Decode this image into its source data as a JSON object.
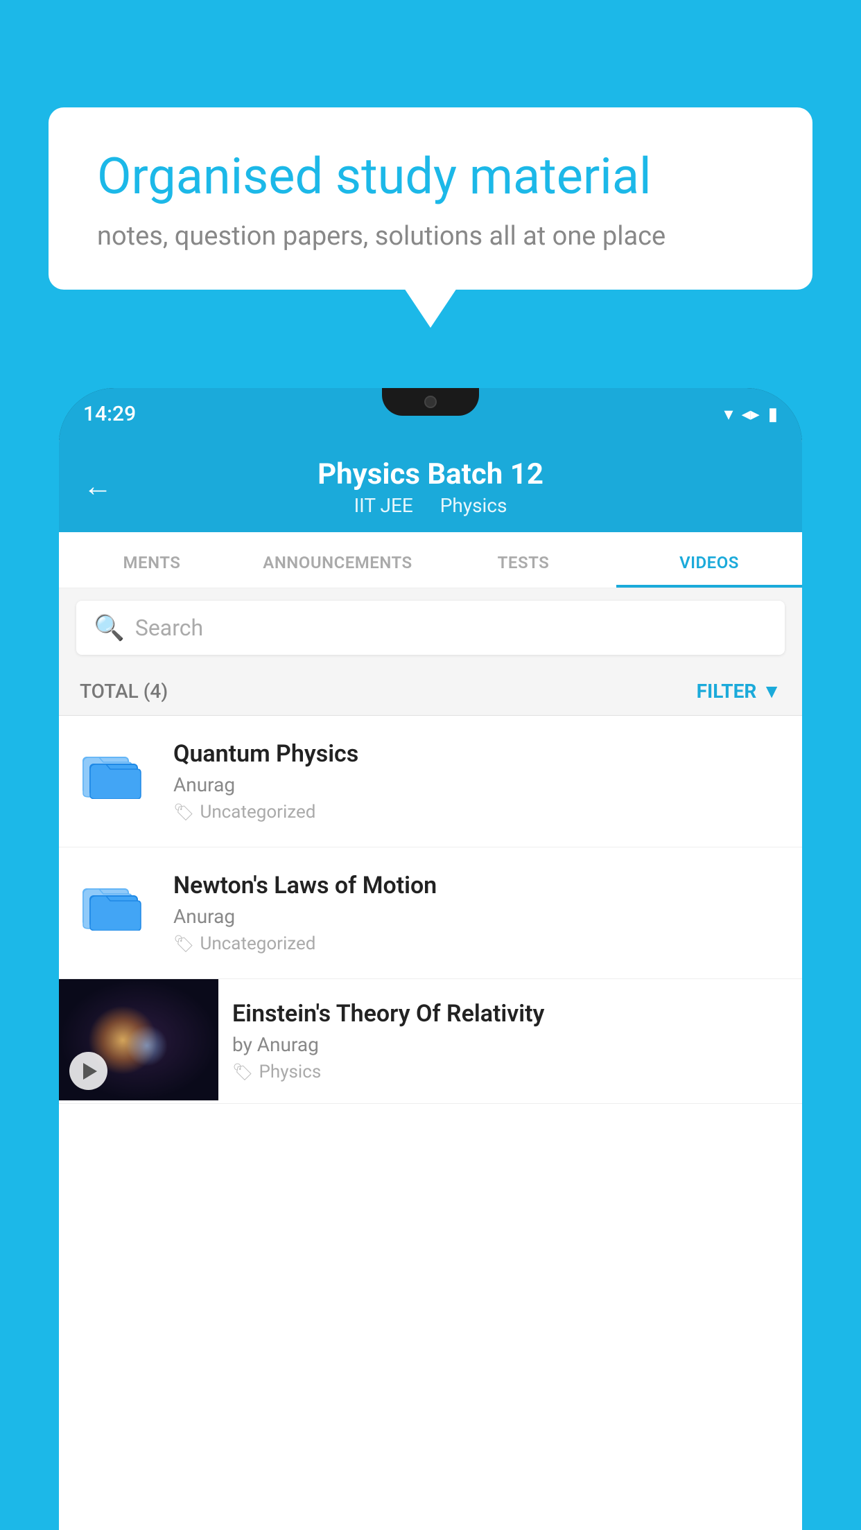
{
  "background_color": "#1cb8e8",
  "speech_bubble": {
    "title": "Organised study material",
    "subtitle": "notes, question papers, solutions all at one place"
  },
  "phone": {
    "status_bar": {
      "time": "14:29",
      "icons": [
        "wifi",
        "signal",
        "battery"
      ]
    },
    "app_header": {
      "back_label": "←",
      "title": "Physics Batch 12",
      "subtitle_parts": [
        "IIT JEE",
        "Physics"
      ]
    },
    "tabs": [
      {
        "label": "MENTS",
        "active": false
      },
      {
        "label": "ANNOUNCEMENTS",
        "active": false
      },
      {
        "label": "TESTS",
        "active": false
      },
      {
        "label": "VIDEOS",
        "active": true
      }
    ],
    "search": {
      "placeholder": "Search"
    },
    "filter_bar": {
      "total_label": "TOTAL (4)",
      "filter_label": "FILTER"
    },
    "video_items": [
      {
        "id": 1,
        "title": "Quantum Physics",
        "author": "Anurag",
        "tag": "Uncategorized",
        "has_thumbnail": false
      },
      {
        "id": 2,
        "title": "Newton's Laws of Motion",
        "author": "Anurag",
        "tag": "Uncategorized",
        "has_thumbnail": false
      },
      {
        "id": 3,
        "title": "Einstein's Theory Of Relativity",
        "author": "by Anurag",
        "tag": "Physics",
        "has_thumbnail": true
      }
    ]
  }
}
